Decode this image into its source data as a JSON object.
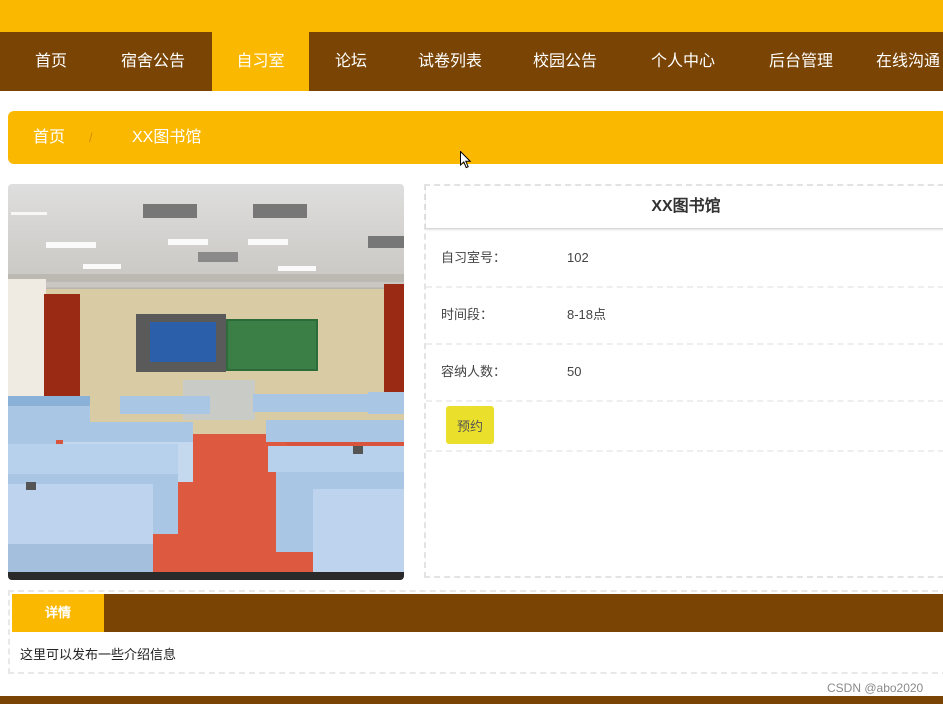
{
  "nav": {
    "items": [
      "首页",
      "宿舍公告",
      "自习室",
      "论坛",
      "试卷列表",
      "校园公告",
      "个人中心",
      "后台管理",
      "在线沟通"
    ],
    "active_index": 2
  },
  "breadcrumb": {
    "home": "首页",
    "separator": "/",
    "current": "XX图书馆"
  },
  "room": {
    "title": "XX图书馆",
    "fields": [
      {
        "label": "自习室号：",
        "value": "102"
      },
      {
        "label": "时间段：",
        "value": "8-18点"
      },
      {
        "label": "容纳人数：",
        "value": "50"
      }
    ],
    "reserve_label": "预约",
    "photo_icon": "classroom-photo"
  },
  "details": {
    "tab_label": "详情",
    "text": "这里可以发布一些介绍信息"
  },
  "watermark": "CSDN @abo2020",
  "colors": {
    "primary": "#fbb800",
    "dark": "#7a4404",
    "button": "#eadf2a"
  }
}
